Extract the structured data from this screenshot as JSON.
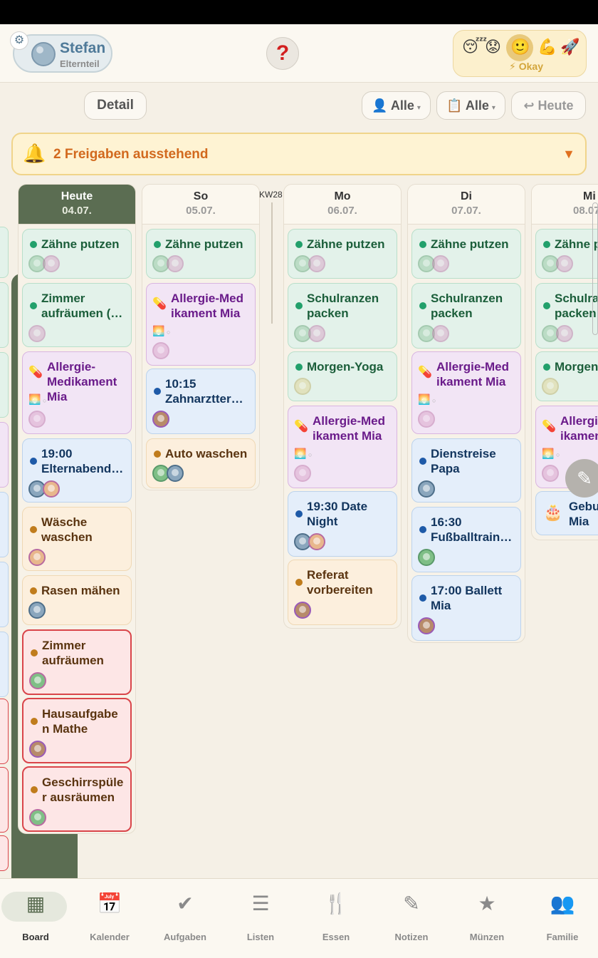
{
  "header": {
    "user_name": "Stefan",
    "user_role": "Elternteil",
    "mood_label": "⚡ Okay",
    "mood_emojis": [
      "😴",
      "😟",
      "🙂",
      "💪",
      "🚀"
    ]
  },
  "toolbar": {
    "board_label": "Board",
    "detail_label": "Detail",
    "filter_person": "Alle",
    "filter_list": "Alle",
    "today_label": "↩ Heute"
  },
  "alert": {
    "text": "2 Freigaben ausstehend"
  },
  "week_label": "KW28",
  "columns": [
    {
      "day": "Heute",
      "date": "04.07."
    },
    {
      "day": "So",
      "date": "05.07."
    },
    {
      "day": "Mo",
      "date": "06.07."
    },
    {
      "day": "Di",
      "date": "07.07."
    },
    {
      "day": "Mi",
      "date": "08.07."
    }
  ],
  "cards": {
    "c0": [
      "Zähne putzen",
      "Zimmer aufräumen (…",
      "Allergie-Medikament Mia",
      "19:00 Elternabend…",
      "Wäsche waschen",
      "Rasen mähen",
      "Zimmer aufräumen",
      "Hausaufgabe n Mathe",
      "Geschirrspüle r ausräumen"
    ],
    "c1": [
      "Zähne putzen",
      "Allergie-Med ikament Mia",
      "10:15 Zahnarztter…",
      "Auto waschen"
    ],
    "c2": [
      "Zähne putzen",
      "Schulranzen packen",
      "Morgen-Yoga",
      "Allergie-Med ikament Mia",
      "19:30 Date Night",
      "Referat vorbereiten"
    ],
    "c3": [
      "Zähne putzen",
      "Schulranzen packen",
      "Allergie-Med ikament Mia",
      "Dienstreise Papa",
      "16:30 Fußballtrain…",
      "17:00 Ballett Mia"
    ],
    "c4": [
      "Zähne p",
      "Schulra packen",
      "Morgen",
      "Allergi ikamen",
      "Gebu Mia"
    ]
  },
  "nav": [
    {
      "label": "Board",
      "icon": "board-icon"
    },
    {
      "label": "Kalender",
      "icon": "calendar-icon"
    },
    {
      "label": "Aufgaben",
      "icon": "check-icon"
    },
    {
      "label": "Listen",
      "icon": "list-icon"
    },
    {
      "label": "Essen",
      "icon": "fork-knife-icon"
    },
    {
      "label": "Notizen",
      "icon": "pencil-icon"
    },
    {
      "label": "Münzen",
      "icon": "star-icon"
    },
    {
      "label": "Familie",
      "icon": "people-icon"
    }
  ]
}
